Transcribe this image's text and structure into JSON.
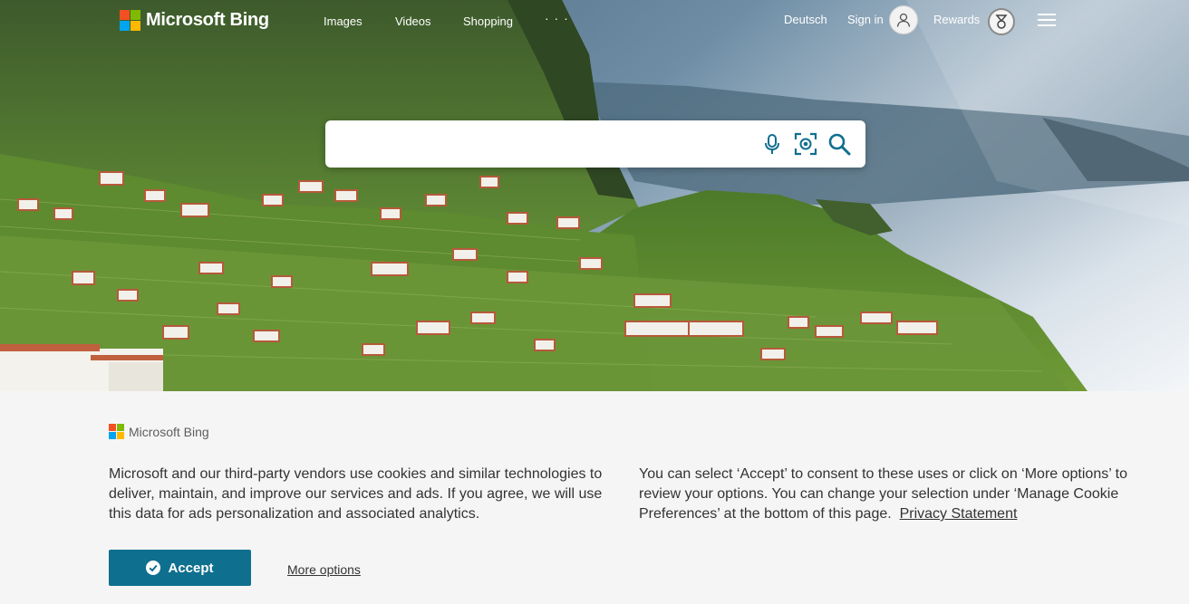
{
  "header": {
    "logo_text": "Microsoft Bing",
    "nav": [
      "Images",
      "Videos",
      "Shopping"
    ],
    "more_dots": "· · ·",
    "language": "Deutsch",
    "sign_in": "Sign in",
    "rewards": "Rewards",
    "logo_colors": [
      "#f25022",
      "#7fba00",
      "#00a4ef",
      "#ffb900"
    ]
  },
  "search": {
    "value": "",
    "placeholder": "",
    "icons": [
      "microphone-icon",
      "visual-search-icon",
      "search-icon"
    ],
    "icon_color": "#0f6f8f"
  },
  "cookie_banner": {
    "logo_text": "Microsoft Bing",
    "left_text": "Microsoft and our third-party vendors use cookies and similar technologies to deliver, maintain, and improve our services and ads. If you agree, we will use this data for ads personalization and associated analytics.",
    "right_text": "You can select ‘Accept’ to consent to these uses or click on ‘More options’ to review your options.  You can change your selection under ‘Manage Cookie Preferences’ at the bottom of this page.",
    "privacy_link": "Privacy Statement",
    "accept_label": "Accept",
    "more_options_label": "More options",
    "accent_color": "#0f6f8f"
  }
}
